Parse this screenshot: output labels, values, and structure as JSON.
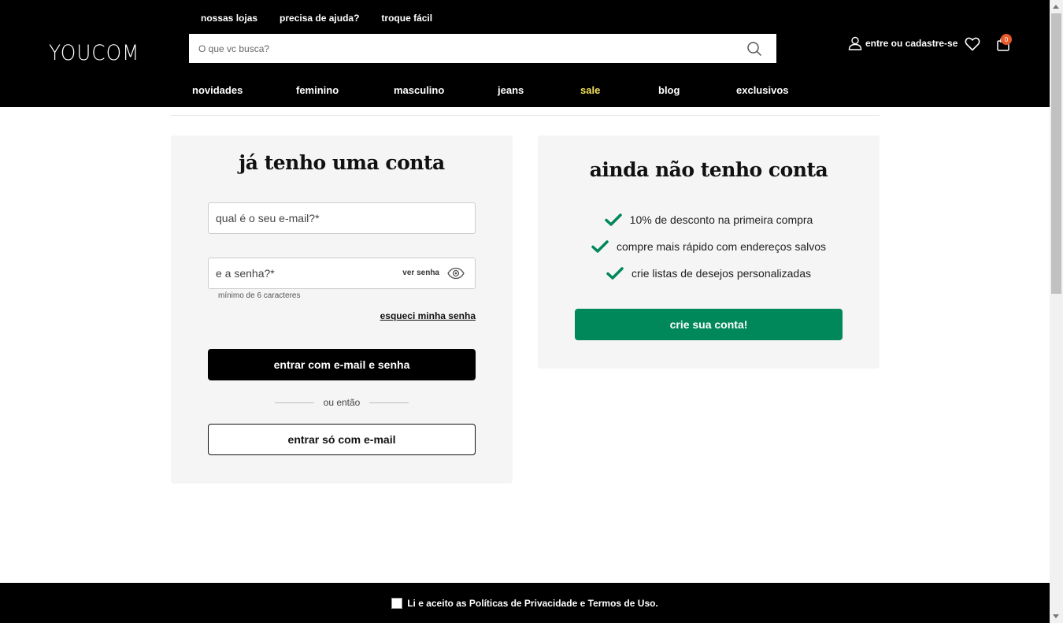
{
  "header": {
    "logo": "YOUCOM",
    "top_links": [
      "nossas lojas",
      "precisa de ajuda?",
      "troque fácil"
    ],
    "search_placeholder": "O que vc busca?",
    "account_label": "entre ou cadastre-se",
    "cart_count": "0"
  },
  "nav": {
    "items": [
      "novidades",
      "feminino",
      "masculino",
      "jeans",
      "sale",
      "blog",
      "exclusivos"
    ],
    "highlight_color": "#f2e15a"
  },
  "login": {
    "title": "já tenho uma conta",
    "email_placeholder": "qual é o seu e-mail?*",
    "password_placeholder": "e a senha?*",
    "show_password": "ver senha",
    "password_hint": "mínimo de 6 caracteres",
    "forgot_password": "esqueci minha senha",
    "submit_label": "entrar com e-mail e senha",
    "or_label": "ou então",
    "email_only_label": "entrar só com e-mail"
  },
  "register": {
    "title": "ainda não tenho conta",
    "benefits": [
      "10% de desconto na primeira compra",
      "compre mais rápido com endereços salvos",
      "crie listas de desejos personalizadas"
    ],
    "cta_label": "crie sua conta!",
    "accent_color": "#00875a"
  },
  "footer": {
    "consent_text": "Li e aceito as Políticas de Privacidade e Termos de Uso."
  }
}
